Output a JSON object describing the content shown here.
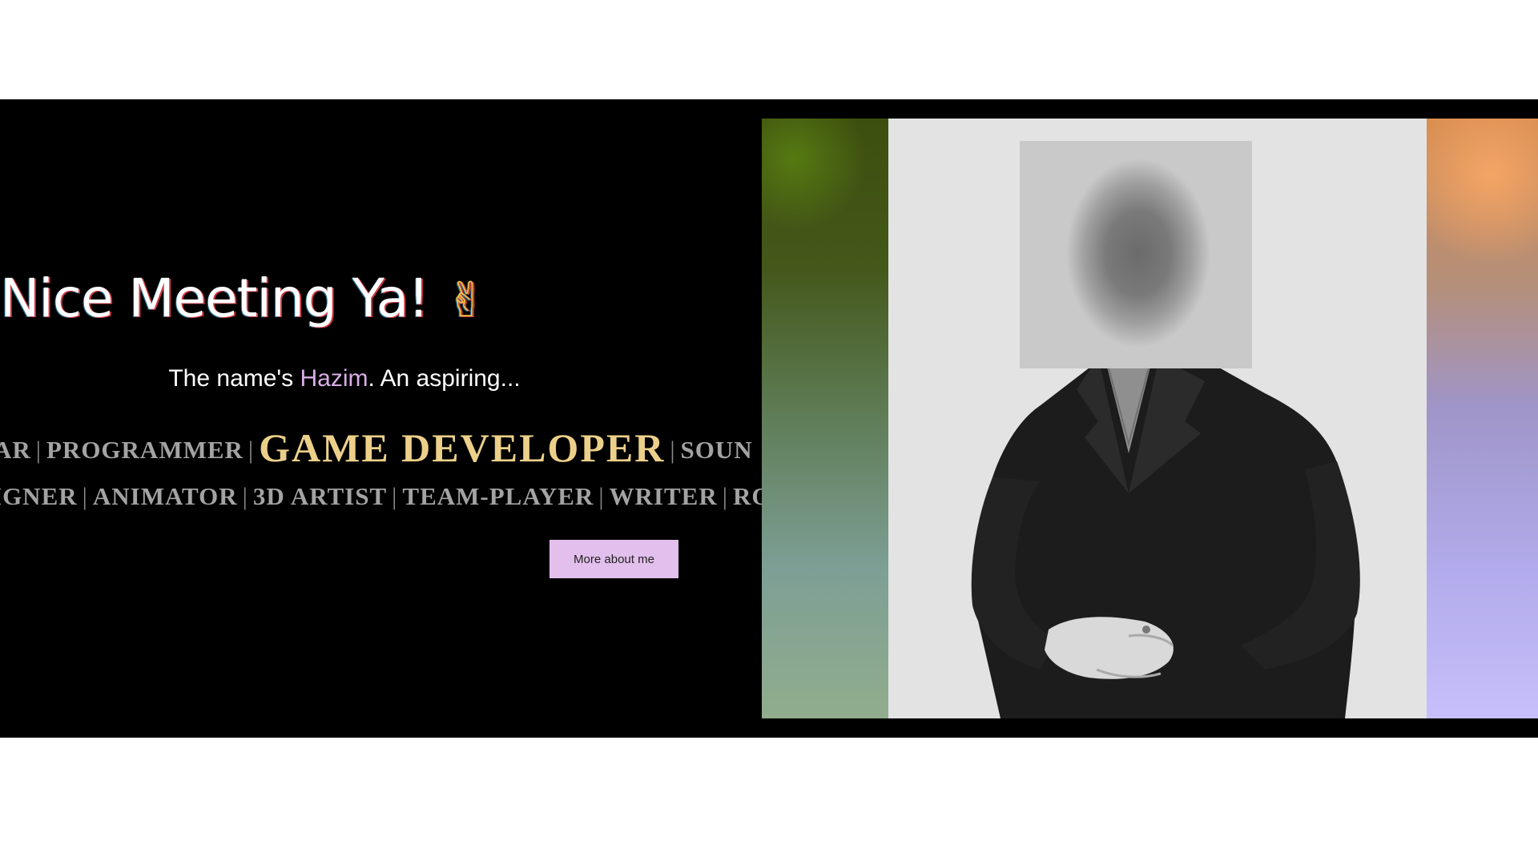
{
  "hero": {
    "headline": "Nice Meeting Ya!",
    "emoji": "✌",
    "intro_prefix": "The name's ",
    "intro_name": "Hazim",
    "intro_suffix": ". An aspiring...",
    "cta_label": "More about me"
  },
  "ticker": {
    "row1": [
      "AR",
      "PROGRAMMER",
      "GAME DEVELOPER",
      "SOUN"
    ],
    "row1_separator": "|",
    "row2": [
      "IGNER",
      "ANIMATOR",
      "3D ARTIST",
      "TEAM-PLAYER",
      "WRITER",
      "RO"
    ],
    "highlighted": "GAME DEVELOPER"
  },
  "colors": {
    "page_background": "#ffffff",
    "band_background": "#000000",
    "name_accent": "#d9aee6",
    "highlight_gold": "#ecd08a",
    "button_background": "#e2bfec"
  },
  "gallery": {
    "icons": [
      "portrait-photo",
      "blurred-face"
    ]
  }
}
